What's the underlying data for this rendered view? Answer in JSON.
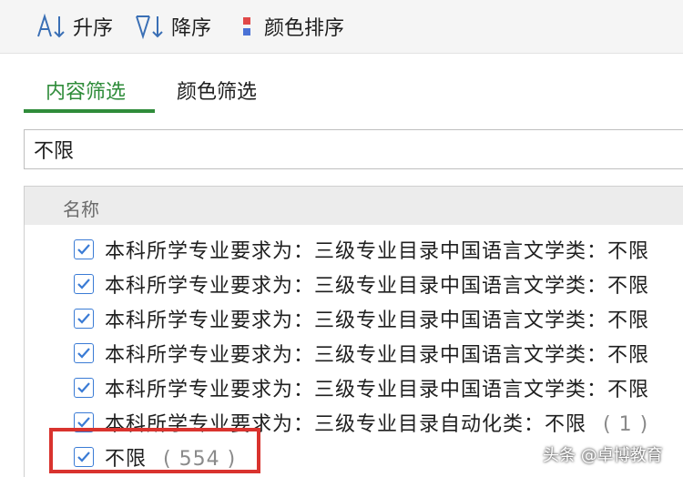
{
  "toolbar": {
    "sort_asc_label": "升序",
    "sort_desc_label": "降序",
    "color_sort_label": "颜色排序"
  },
  "tabs": {
    "content_filter": "内容筛选",
    "color_filter": "颜色筛选"
  },
  "search": {
    "value": "不限"
  },
  "list": {
    "header": "名称",
    "items": [
      {
        "label": "本科所学专业要求为：三级专业目录中国语言文学类：不限",
        "count": "",
        "checked": true
      },
      {
        "label": "本科所学专业要求为：三级专业目录中国语言文学类：不限",
        "count": "",
        "checked": true
      },
      {
        "label": "本科所学专业要求为：三级专业目录中国语言文学类：不限",
        "count": "",
        "checked": true
      },
      {
        "label": "本科所学专业要求为：三级专业目录中国语言文学类：不限",
        "count": "",
        "checked": true
      },
      {
        "label": "本科所学专业要求为：三级专业目录中国语言文学类：不限",
        "count": "",
        "checked": true
      },
      {
        "label": "本科所学专业要求为：三级专业目录自动化类：不限",
        "count": "( 1 )",
        "checked": true
      },
      {
        "label": "不限",
        "count": "( 554 )",
        "checked": true
      }
    ]
  },
  "colors": {
    "accent": "#2f8c3a",
    "checkbox": "#3a7bd5",
    "highlight": "#d9332e"
  },
  "watermark": "头条 @卓博教育"
}
